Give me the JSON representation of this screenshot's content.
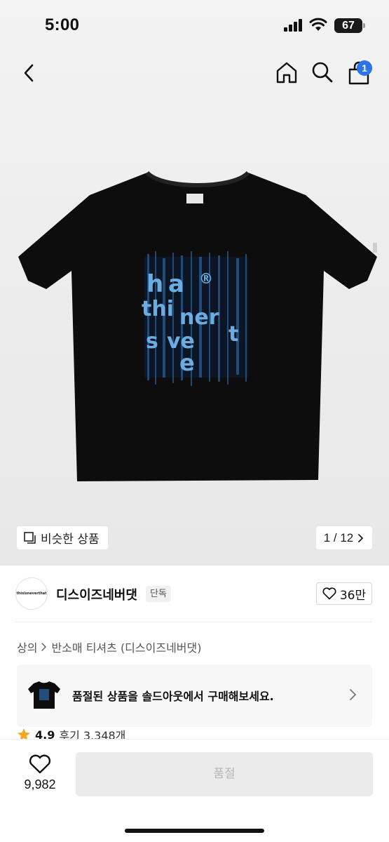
{
  "status_bar": {
    "time": "5:00",
    "battery": "67"
  },
  "nav": {
    "cart_count": "1",
    "icons": [
      "back-icon",
      "home-icon",
      "search-icon",
      "cart-icon"
    ]
  },
  "gallery": {
    "similar_label": "비슷한 상품",
    "page_indicator": "1 / 12"
  },
  "brand": {
    "logo_text": "thisisneverthat",
    "name": "디스이즈네버댓",
    "tag": "단독",
    "likes": "36만"
  },
  "breadcrumb": {
    "category": "상의",
    "subcategory": "반소매 티셔츠 (디스이즈네버댓)"
  },
  "soldout_card": {
    "message": "품절된 상품을 솔드아웃에서 구매해보세요."
  },
  "rating": {
    "score": "4.9",
    "reviews": "후기 3,348개"
  },
  "bottom_bar": {
    "wish_count": "9,982",
    "buy_label": "품절"
  },
  "colors": {
    "accent": "#2a73e8",
    "star": "#f5a623",
    "shirt": "#0d0d0d",
    "print": "#5aa9e6"
  }
}
